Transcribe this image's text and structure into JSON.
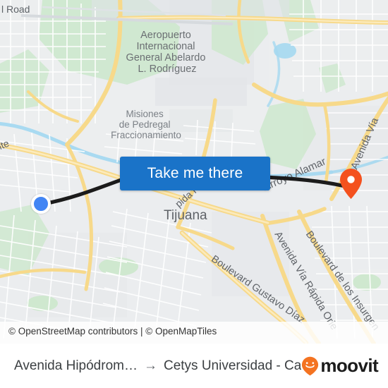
{
  "map": {
    "labels": {
      "airport": "Aeropuerto\nInternacional\nGeneral Abelardo\nL. Rodríguez",
      "airport_lines": [
        "Aeropuerto",
        "Internacional",
        "General Abelardo",
        "L. Rodríguez"
      ],
      "neighborhood_lines": [
        "Misiones",
        "de Pedregal",
        "Fraccionamiento"
      ],
      "city": "Tijuana",
      "road_via_rapida_poniente": "pida Poniente",
      "road_via_rapida_poniente_left": "nte",
      "road_arroyo_alamar": "Arroyo Alamar",
      "road_diaz_ordaz": "Boulevard Gustavo Díaz Ordaz",
      "road_via_rapida_oriente": "Avenida Vía Rápida Oriente",
      "road_insurgentes": "Boulevard de los Insurgentes",
      "road_avenida_via": "Avenida Vía",
      "road_top_left": "l Road"
    },
    "colors": {
      "land": "#eef0f2",
      "block": "#e8eaed",
      "park": "#cfe8cf",
      "water": "#a5d8f0",
      "arterial": "#f7d98a",
      "arterial_minor": "#fbe9b8",
      "street": "#ffffff",
      "route_line": "#1b1b1b",
      "origin": "#4285f4",
      "destination": "#f4511e",
      "accent_button": "#1a73c8"
    },
    "overlay_button_label": "Take me there",
    "markers": {
      "origin_name": "origin-marker",
      "destination_name": "destination-marker"
    }
  },
  "attribution": {
    "text": "© OpenStreetMap contributors | © OpenMapTiles"
  },
  "bottom_bar": {
    "origin": "Avenida Hipódrom…",
    "arrow": "→",
    "destination": "Cetys Universidad - Campus …",
    "brand": "moovit"
  }
}
